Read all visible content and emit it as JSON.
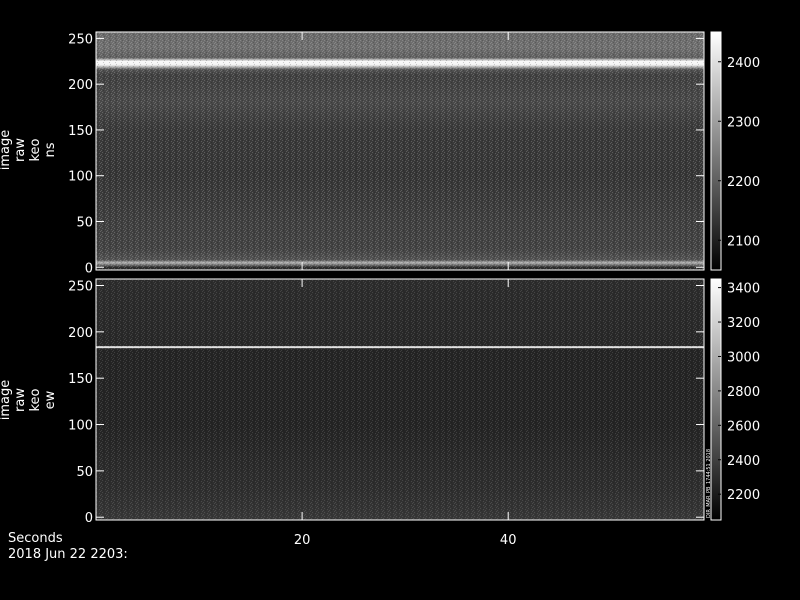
{
  "chart_data": [
    {
      "type": "heatmap",
      "ylabel_lines": [
        "image",
        "raw",
        "keo",
        "ns"
      ],
      "x_ticks": [
        20,
        40
      ],
      "xlim": [
        0,
        59
      ],
      "y_ticks": [
        0,
        50,
        100,
        150,
        200,
        250
      ],
      "ylim": [
        -3,
        257
      ],
      "colorbar": {
        "ticks": [
          2100,
          2200,
          2300,
          2400
        ],
        "range": [
          2050,
          2450
        ]
      },
      "row_profile": [
        {
          "y": 0,
          "v": 2120
        },
        {
          "y": 5,
          "v": 2330
        },
        {
          "y": 8,
          "v": 2180
        },
        {
          "y": 20,
          "v": 2155
        },
        {
          "y": 45,
          "v": 2150
        },
        {
          "y": 100,
          "v": 2135
        },
        {
          "y": 150,
          "v": 2140
        },
        {
          "y": 180,
          "v": 2165
        },
        {
          "y": 210,
          "v": 2150
        },
        {
          "y": 216,
          "v": 2180
        },
        {
          "y": 221,
          "v": 2430
        },
        {
          "y": 225,
          "v": 2440
        },
        {
          "y": 229,
          "v": 2200
        },
        {
          "y": 240,
          "v": 2225
        },
        {
          "y": 256,
          "v": 2215
        }
      ]
    },
    {
      "type": "heatmap",
      "ylabel_lines": [
        "image",
        "raw",
        "keo",
        "ew"
      ],
      "x_ticks": [
        20,
        40
      ],
      "xlim": [
        0,
        59
      ],
      "y_ticks": [
        0,
        50,
        100,
        150,
        200,
        250
      ],
      "ylim": [
        -3,
        257
      ],
      "colorbar": {
        "ticks": [
          2200,
          2400,
          2600,
          2800,
          3000,
          3200,
          3400
        ],
        "range": [
          2050,
          3450
        ]
      },
      "colorbar_side_text": "DIR_MAR_PB_1744:51 2018",
      "row_profile": [
        {
          "y": 0,
          "v": 2350
        },
        {
          "y": 10,
          "v": 2330
        },
        {
          "y": 30,
          "v": 2300
        },
        {
          "y": 100,
          "v": 2250
        },
        {
          "y": 180,
          "v": 2245
        },
        {
          "y": 182,
          "v": 2260
        },
        {
          "y": 183,
          "v": 3380
        },
        {
          "y": 184,
          "v": 3380
        },
        {
          "y": 185,
          "v": 2270
        },
        {
          "y": 220,
          "v": 2280
        },
        {
          "y": 256,
          "v": 2290
        }
      ]
    }
  ],
  "footer": {
    "x_axis_label": "Seconds",
    "date_label": "2018 Jun 22 2203:"
  }
}
